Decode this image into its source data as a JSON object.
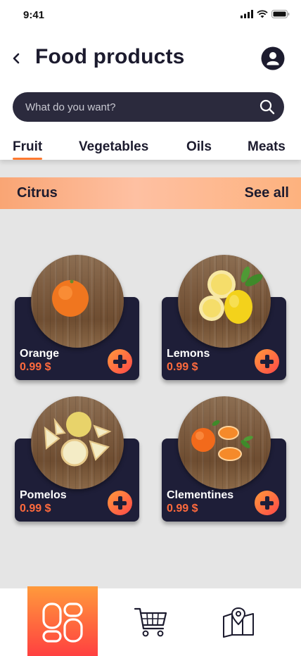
{
  "status_bar": {
    "time": "9:41"
  },
  "header": {
    "title": "Food products"
  },
  "search": {
    "placeholder": "What do you want?"
  },
  "tabs": [
    {
      "label": "Fruit",
      "active": true
    },
    {
      "label": "Vegetables",
      "active": false
    },
    {
      "label": "Oils",
      "active": false
    },
    {
      "label": "Meats",
      "active": false
    }
  ],
  "section": {
    "title": "Citrus",
    "see_all": "See all"
  },
  "products": [
    {
      "name": "Orange",
      "price": "0.99 $"
    },
    {
      "name": "Lemons",
      "price": "0.99 $"
    },
    {
      "name": "Pomelos",
      "price": "0.99 $"
    },
    {
      "name": "Clementines",
      "price": "0.99 $"
    }
  ],
  "bottom_nav": {
    "items": [
      {
        "icon": "grid-icon",
        "active": true
      },
      {
        "icon": "cart-icon",
        "active": false
      },
      {
        "icon": "map-icon",
        "active": false
      }
    ]
  },
  "colors": {
    "primary_dark": "#1e1e38",
    "accent_orange": "#ff7a30",
    "accent_red": "#ff4848",
    "price": "#ff6a3d"
  }
}
